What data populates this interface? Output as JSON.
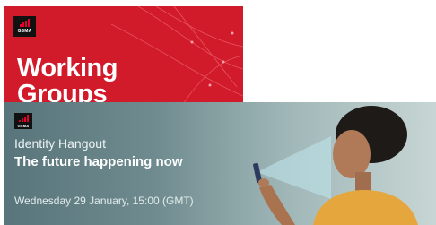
{
  "working_groups_banner": {
    "logo_text": "GSMA",
    "title_line1": "Working",
    "title_line2": "Groups",
    "background_color": "#d11a2a"
  },
  "identity_hangout_banner": {
    "logo_text": "GSMA",
    "subtitle": "Identity Hangout",
    "title": "The future happening now",
    "date_text": "Wednesday 29 January, 15:00 (GMT)",
    "background_color": "#6f8b8f"
  }
}
